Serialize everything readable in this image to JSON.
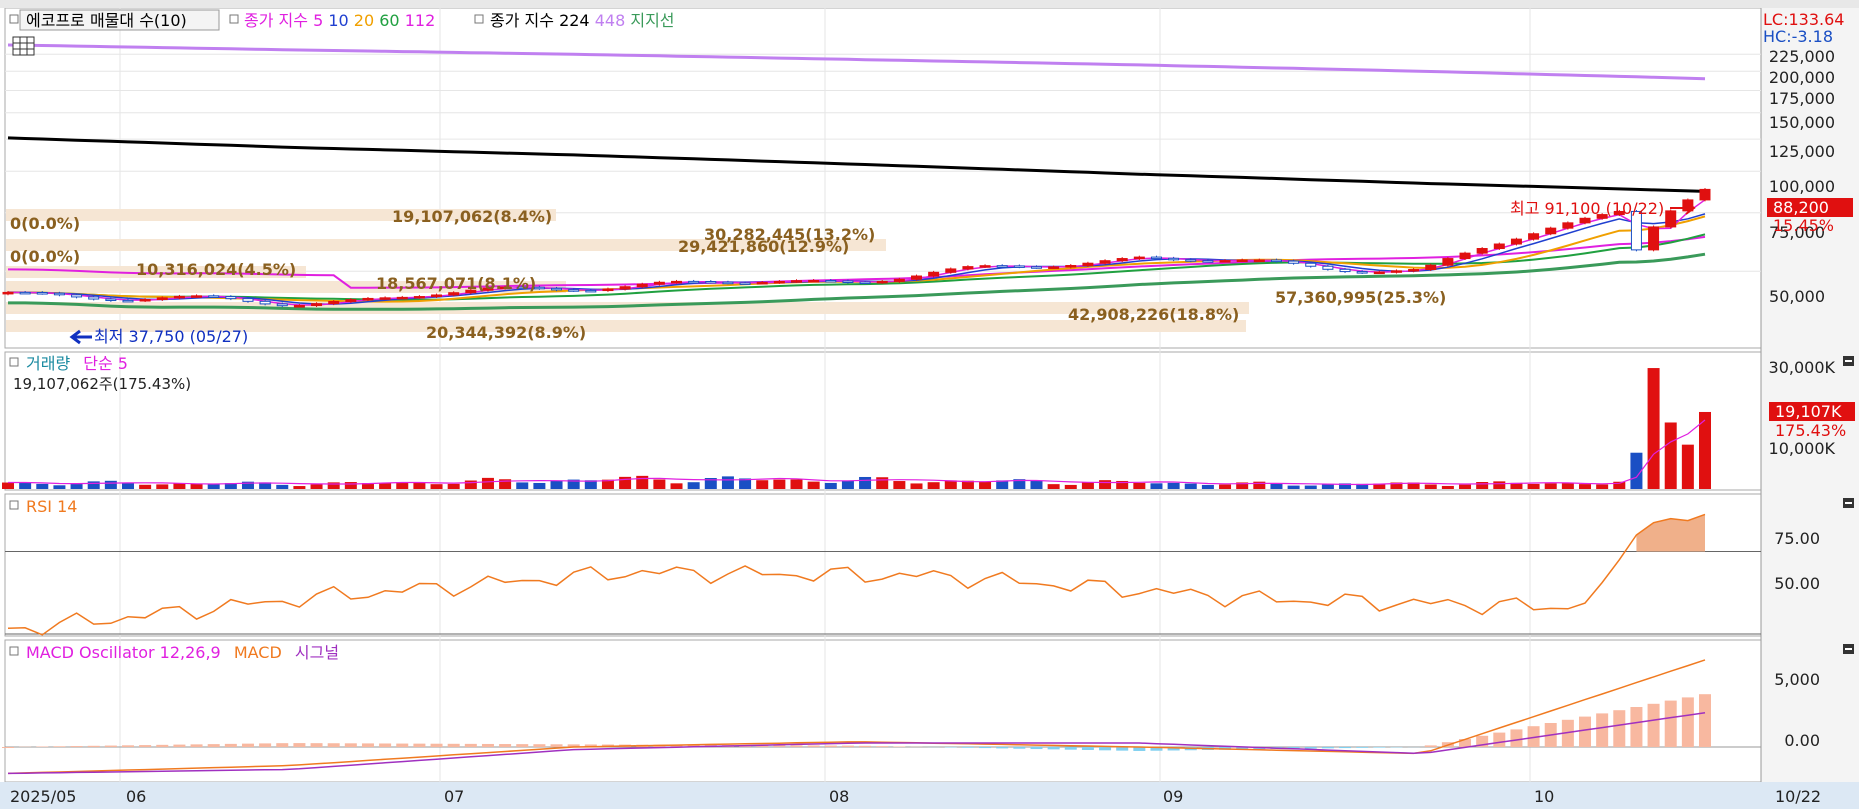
{
  "colors": {
    "up": "#e01010",
    "down": "#1a4fc4",
    "ma5": "#e020e0",
    "ma10": "#2040d0",
    "ma20": "#f0a000",
    "ma60": "#20a040",
    "ma112": "#e020e0",
    "ma224": "#000000",
    "ma448": "#c080f0",
    "support": "#3a9a5a",
    "rsi": "#f07a20",
    "rsiFill": "#f0b08a",
    "macd": "#f07a20",
    "signal": "#a030c0",
    "osc_pos": "#f8b8a0",
    "osc_neg": "#80d0f0",
    "profile": "#f6e6d4",
    "profileText": "#8a6020"
  },
  "main_legend": {
    "profile_label": "에코프로 매물대 수(10)",
    "close_ma_label": "종가 지수",
    "p5": "5",
    "p10": "10",
    "p20": "20",
    "p60": "60",
    "p112": "112",
    "close_ma2_label": "종가 지수",
    "p224": "224",
    "p448": "448",
    "support_label": "지지선"
  },
  "price_axis": {
    "ticks": [
      "225,000",
      "200,000",
      "175,000",
      "150,000",
      "125,000",
      "100,000",
      "75,000",
      "50,000"
    ],
    "lc": "LC:133.64",
    "hc": "HC:-3.18",
    "current": "88,200",
    "current_pct": "15.45%"
  },
  "price_annotations": {
    "high": "최고 91,100 (10/22)",
    "low": "최저 37,750 (05/27)"
  },
  "profile_labels": [
    "0(0.0%)",
    "0(0.0%)",
    "19,107,062(8.4%)",
    "30,282,445(13.2%)",
    "29,421,860(12.9%)",
    "10,316,024(4.5%)",
    "18,567,071(8.1%)",
    "20,344,392(8.9%)",
    "42,908,226(18.8%)",
    "57,360,995(25.3%)"
  ],
  "volume_legend": {
    "label": "거래량",
    "ma_label": "단순 5",
    "info": "19,107,062주(175.43%)"
  },
  "volume_axis": {
    "ticks": [
      "30,000K",
      "10,000K"
    ],
    "current": "19,107K",
    "current_pct": "175.43%"
  },
  "rsi_legend": {
    "label": "RSI 14"
  },
  "rsi_axis": {
    "ticks": [
      "75.00",
      "50.00"
    ]
  },
  "macd_legend": {
    "label": "MACD Oscillator 12,26,9",
    "macd": "MACD",
    "signal": "시그널"
  },
  "macd_axis": {
    "ticks": [
      "5,000",
      "0.00"
    ]
  },
  "x_axis": {
    "labels": [
      "2025/05",
      "06",
      "07",
      "08",
      "09",
      "10"
    ],
    "last": "10/22"
  },
  "chart_data": [
    {
      "type": "candlestick",
      "title": "에코프로 매물대 수(10)",
      "x": [
        "2025/05",
        "06",
        "07",
        "08",
        "09",
        "10",
        "10/22"
      ],
      "series": [
        {
          "name": "종가",
          "values_approx": [
            43000,
            40000,
            45000,
            47000,
            55000,
            50000,
            88200
          ]
        },
        {
          "name": "종가 지수 224",
          "values_approx": [
            126000,
            118000,
            112000,
            105000,
            98000,
            92000,
            87000
          ]
        },
        {
          "name": "종가 지수 448",
          "values_approx": [
            240000,
            232000,
            225000,
            217000,
            209000,
            200000,
            190000
          ]
        }
      ],
      "ylim": [
        30000,
        235000
      ],
      "y_scale": "log",
      "high": 91100,
      "low": 37750,
      "current": 88200
    },
    {
      "type": "bar",
      "title": "거래량",
      "x": [
        "2025/05",
        "06",
        "07",
        "08",
        "09",
        "10",
        "10/22"
      ],
      "values_K": [
        1500,
        1300,
        2500,
        2000,
        1200,
        1500,
        19107
      ],
      "peak_K": 30000,
      "ylim_K": [
        0,
        32000
      ]
    },
    {
      "type": "line",
      "title": "RSI 14",
      "x": [
        "2025/05",
        "06",
        "07",
        "08",
        "09",
        "10",
        "10/22"
      ],
      "values": [
        32,
        48,
        60,
        58,
        47,
        43,
        88
      ],
      "ylim": [
        30,
        95
      ],
      "reference_lines": [
        30,
        70
      ]
    },
    {
      "type": "line",
      "title": "MACD Oscillator 12,26,9",
      "x": [
        "2025/05",
        "06",
        "07",
        "08",
        "09",
        "10",
        "10/22"
      ],
      "series": [
        {
          "name": "MACD",
          "values": [
            -2000,
            -1400,
            0,
            400,
            0,
            -500,
            6600
          ]
        },
        {
          "name": "시그널",
          "values": [
            -2000,
            -1700,
            -200,
            300,
            300,
            -500,
            2600
          ]
        }
      ],
      "ylim": [
        -2500,
        7500
      ]
    }
  ]
}
